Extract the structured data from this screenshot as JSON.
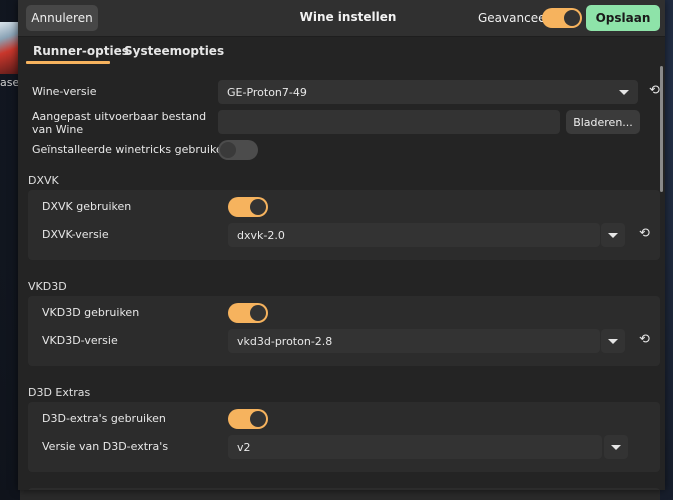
{
  "background": {
    "thumb_label": "ase"
  },
  "header": {
    "cancel_label": "Annuleren",
    "title": "Wine instellen",
    "advanced_label": "Geavanceerd",
    "advanced_enabled": true,
    "save_label": "Opslaan"
  },
  "tabs": [
    {
      "label": "Runner-opties",
      "active": true
    },
    {
      "label": "Systeemopties",
      "active": false
    }
  ],
  "wine": {
    "version_label": "Wine-versie",
    "version_value": "GE-Proton7-49",
    "custom_exe_label": "Aangepast uitvoerbaar bestand van Wine",
    "custom_exe_value": "",
    "browse_label": "Bladeren...",
    "winetricks_label": "Geïnstalleerde winetricks gebruiken",
    "winetricks_enabled": false
  },
  "dxvk": {
    "section_title": "DXVK",
    "use_label": "DXVK gebruiken",
    "use_enabled": true,
    "version_label": "DXVK-versie",
    "version_value": "dxvk-2.0"
  },
  "vkd3d": {
    "section_title": "VKD3D",
    "use_label": "VKD3D gebruiken",
    "use_enabled": true,
    "version_label": "VKD3D-versie",
    "version_value": "vkd3d-proton-2.8"
  },
  "d3d": {
    "section_title": "D3D Extras",
    "use_label": "D3D-extra's gebruiken",
    "use_enabled": true,
    "version_label": "Versie van D3D-extra's",
    "version_value": "v2"
  },
  "colors": {
    "accent": "#f6b35e",
    "save_bg": "#8ee3a9",
    "dialog_bg": "#242424",
    "header_bg": "#303030"
  },
  "icons": {
    "dropdown": "chevron-down-icon",
    "reset": "undo-icon"
  }
}
